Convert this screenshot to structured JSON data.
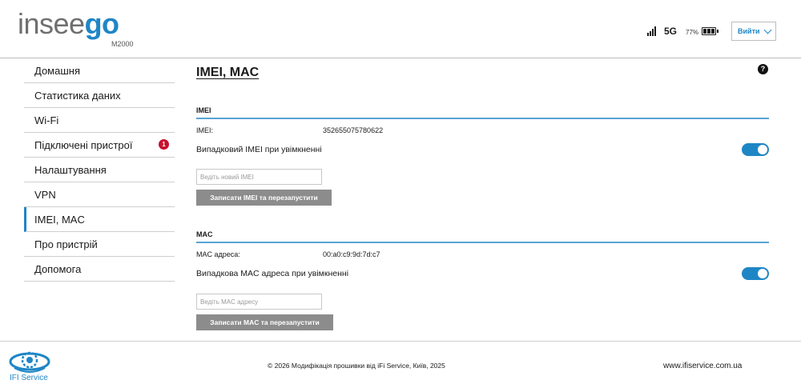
{
  "header": {
    "logo_part1": "insee",
    "logo_part2": "go",
    "model": "M2000",
    "network": "5G",
    "battery_percent": "77%",
    "logout_label": "Вийти"
  },
  "sidebar": {
    "items": [
      {
        "label": "Домашня"
      },
      {
        "label": "Статистика даних"
      },
      {
        "label": "Wi-Fi"
      },
      {
        "label": "Підключені пристрої",
        "badge": "1"
      },
      {
        "label": "Налаштування"
      },
      {
        "label": "VPN"
      },
      {
        "label": "IMEI, MAC",
        "active": true
      },
      {
        "label": "Про пристрій"
      },
      {
        "label": "Допомога"
      }
    ]
  },
  "main": {
    "title": "IMEI, MAC",
    "help": "?",
    "imei": {
      "section_title": "IMEI",
      "label": "IMEI:",
      "value": "352655075780622",
      "random_label": "Випадковий IMEI при увімкненні",
      "random_enabled": true,
      "input_placeholder": "Ведіть новий IMEI",
      "input_value": "",
      "button_label": "Записати IMEI та перезапустити"
    },
    "mac": {
      "section_title": "MAC",
      "label": "MAC адреса:",
      "value": "00:a0:c9:9d:7d:c7",
      "random_label": "Випадкова MAC адреса при увімкненні",
      "random_enabled": true,
      "input_placeholder": "Ведіть MAC адресу",
      "input_value": "",
      "button_label": "Записати MAC та перезапустити"
    }
  },
  "footer": {
    "logo_text": "IFI Service",
    "copyright": "© 2026 Модифікація прошивки від iFi Service, Київ, 2025",
    "site": "www.ifiservice.com.ua"
  },
  "colors": {
    "accent": "#1f86c6",
    "badge": "#c8102e",
    "button_gray": "#8c8c8c"
  }
}
